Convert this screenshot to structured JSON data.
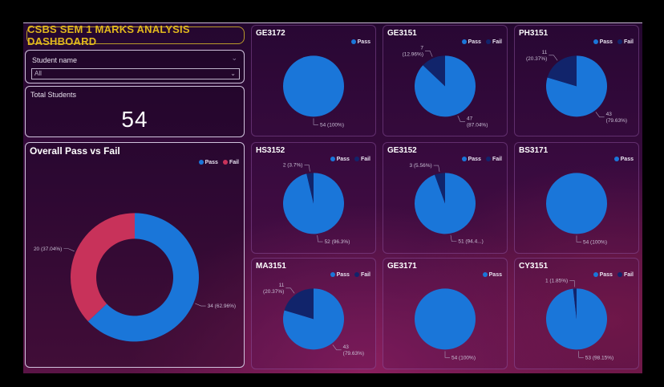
{
  "dashboard": {
    "title": "CSBS SEM 1 MARKS ANALYSIS DASHBOARD",
    "slicer": {
      "label": "Student name",
      "value": "All"
    },
    "card": {
      "label": "Total Students",
      "value": "54"
    }
  },
  "colors": {
    "pass": "#1a76d9",
    "fail_pie": "#11246b",
    "fail_overall": "#c8325a"
  },
  "legend": {
    "pass": "Pass",
    "fail": "Fail"
  },
  "chart_data": [
    {
      "id": "overall",
      "type": "pie",
      "donut": true,
      "title": "Overall Pass vs Fail",
      "legend": [
        "Pass",
        "Fail"
      ],
      "slices": [
        {
          "label": "Pass",
          "value": 34,
          "text": "34 (62.96%)"
        },
        {
          "label": "Fail",
          "value": 20,
          "text": "20 (37.04%)"
        }
      ]
    },
    {
      "id": "GE3172",
      "type": "pie",
      "title": "GE3172",
      "legend": [
        "Pass"
      ],
      "slices": [
        {
          "label": "Pass",
          "value": 54,
          "text": "54 (100%)"
        }
      ]
    },
    {
      "id": "GE3151",
      "type": "pie",
      "title": "GE3151",
      "legend": [
        "Pass",
        "Fail"
      ],
      "slices": [
        {
          "label": "Pass",
          "value": 47,
          "text": "47\n(87.04%)"
        },
        {
          "label": "Fail",
          "value": 7,
          "text": "7\n(12.96%)"
        }
      ]
    },
    {
      "id": "PH3151",
      "type": "pie",
      "title": "PH3151",
      "legend": [
        "Pass",
        "Fail"
      ],
      "slices": [
        {
          "label": "Pass",
          "value": 43,
          "text": "43\n(79.63%)"
        },
        {
          "label": "Fail",
          "value": 11,
          "text": "11\n(20.37%)"
        }
      ]
    },
    {
      "id": "HS3152",
      "type": "pie",
      "title": "HS3152",
      "legend": [
        "Pass",
        "Fail"
      ],
      "slices": [
        {
          "label": "Pass",
          "value": 52,
          "text": "52 (96.3%)"
        },
        {
          "label": "Fail",
          "value": 2,
          "text": "2 (3.7%)"
        }
      ]
    },
    {
      "id": "GE3152",
      "type": "pie",
      "title": "GE3152",
      "legend": [
        "Pass",
        "Fail"
      ],
      "slices": [
        {
          "label": "Pass",
          "value": 51,
          "text": "51 (94.4...)"
        },
        {
          "label": "Fail",
          "value": 3,
          "text": "3 (5.56%)"
        }
      ]
    },
    {
      "id": "BS3171",
      "type": "pie",
      "title": "BS3171",
      "legend": [
        "Pass"
      ],
      "slices": [
        {
          "label": "Pass",
          "value": 54,
          "text": "54 (100%)"
        }
      ]
    },
    {
      "id": "MA3151",
      "type": "pie",
      "title": "MA3151",
      "legend": [
        "Pass",
        "Fail"
      ],
      "slices": [
        {
          "label": "Pass",
          "value": 43,
          "text": "43\n(79.63%)"
        },
        {
          "label": "Fail",
          "value": 11,
          "text": "11\n(20.37%)"
        }
      ]
    },
    {
      "id": "GE3171",
      "type": "pie",
      "title": "GE3171",
      "legend": [
        "Pass"
      ],
      "slices": [
        {
          "label": "Pass",
          "value": 54,
          "text": "54 (100%)"
        }
      ]
    },
    {
      "id": "CY3151",
      "type": "pie",
      "title": "CY3151",
      "legend": [
        "Pass",
        "Fail"
      ],
      "slices": [
        {
          "label": "Pass",
          "value": 53,
          "text": "53 (98.15%)"
        },
        {
          "label": "Fail",
          "value": 1,
          "text": "1 (1.85%)"
        }
      ]
    }
  ]
}
